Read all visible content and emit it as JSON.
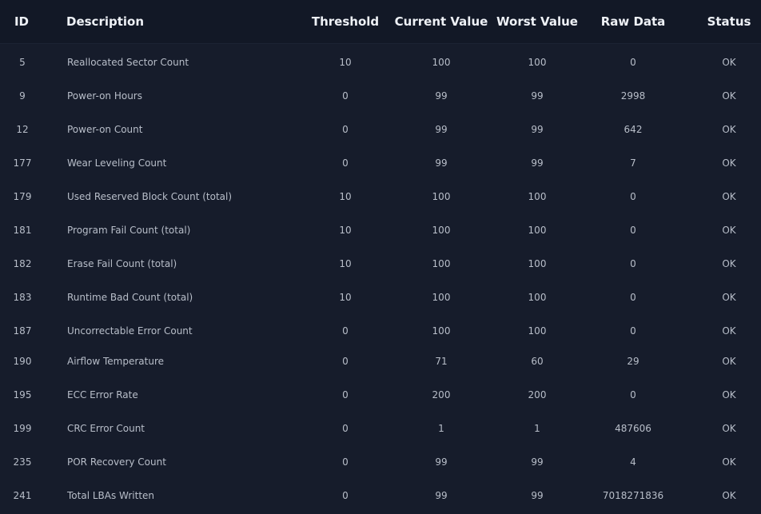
{
  "columns": {
    "id": "ID",
    "description": "Description",
    "threshold": "Threshold",
    "current": "Current Value",
    "worst": "Worst Value",
    "raw": "Raw Data",
    "status": "Status"
  },
  "rows": [
    {
      "id": "5",
      "description": "Reallocated Sector Count",
      "threshold": "10",
      "current": "100",
      "worst": "100",
      "raw": "0",
      "status": "OK"
    },
    {
      "id": "9",
      "description": "Power-on Hours",
      "threshold": "0",
      "current": "99",
      "worst": "99",
      "raw": "2998",
      "status": "OK"
    },
    {
      "id": "12",
      "description": "Power-on Count",
      "threshold": "0",
      "current": "99",
      "worst": "99",
      "raw": "642",
      "status": "OK"
    },
    {
      "id": "177",
      "description": "Wear Leveling Count",
      "threshold": "0",
      "current": "99",
      "worst": "99",
      "raw": "7",
      "status": "OK"
    },
    {
      "id": "179",
      "description": "Used Reserved Block Count (total)",
      "threshold": "10",
      "current": "100",
      "worst": "100",
      "raw": "0",
      "status": "OK"
    },
    {
      "id": "181",
      "description": "Program Fail Count (total)",
      "threshold": "10",
      "current": "100",
      "worst": "100",
      "raw": "0",
      "status": "OK"
    },
    {
      "id": "182",
      "description": "Erase Fail Count (total)",
      "threshold": "10",
      "current": "100",
      "worst": "100",
      "raw": "0",
      "status": "OK"
    },
    {
      "id": "183",
      "description": "Runtime Bad Count (total)",
      "threshold": "10",
      "current": "100",
      "worst": "100",
      "raw": "0",
      "status": "OK"
    },
    {
      "id": "187",
      "description": "Uncorrectable Error Count",
      "threshold": "0",
      "current": "100",
      "worst": "100",
      "raw": "0",
      "status": "OK"
    },
    {
      "id": "190",
      "description": "Airflow Temperature",
      "threshold": "0",
      "current": "71",
      "worst": "60",
      "raw": "29",
      "status": "OK"
    },
    {
      "id": "195",
      "description": "ECC Error Rate",
      "threshold": "0",
      "current": "200",
      "worst": "200",
      "raw": "0",
      "status": "OK"
    },
    {
      "id": "199",
      "description": "CRC Error Count",
      "threshold": "0",
      "current": "1",
      "worst": "1",
      "raw": "487606",
      "status": "OK"
    },
    {
      "id": "235",
      "description": "POR Recovery Count",
      "threshold": "0",
      "current": "99",
      "worst": "99",
      "raw": "4",
      "status": "OK"
    },
    {
      "id": "241",
      "description": "Total LBAs Written",
      "threshold": "0",
      "current": "99",
      "worst": "99",
      "raw": "7018271836",
      "status": "OK"
    }
  ]
}
